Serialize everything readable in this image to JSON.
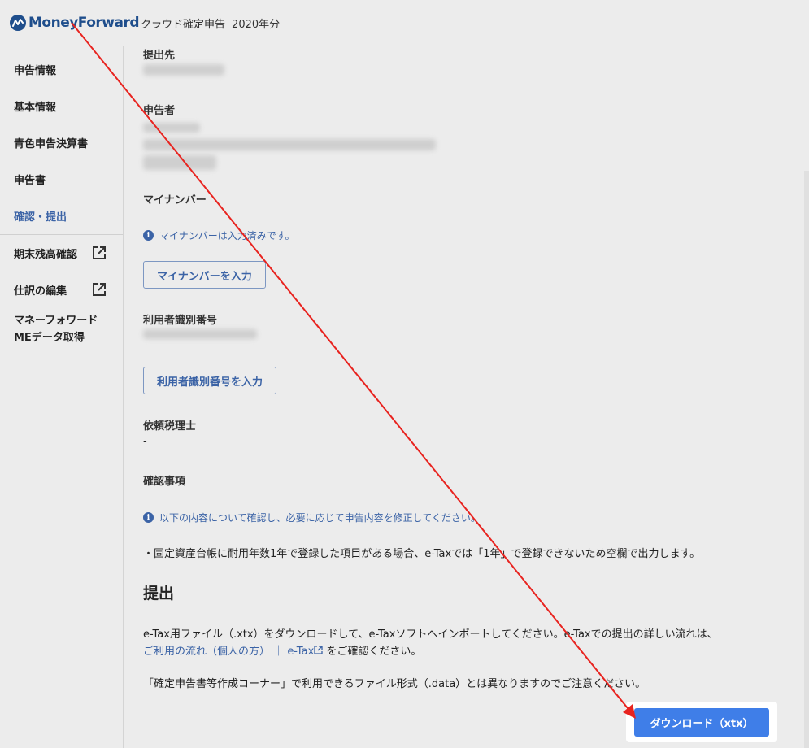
{
  "header": {
    "logo_text": "MoneyForward",
    "product": "クラウド確定申告",
    "year": "2020年分"
  },
  "sidebar": {
    "items": [
      {
        "label": "申告情報"
      },
      {
        "label": "基本情報"
      },
      {
        "label": "青色申告決算書"
      },
      {
        "label": "申告書"
      },
      {
        "label": "確認・提出"
      },
      {
        "label": "期末残高確認"
      },
      {
        "label": "仕訳の編集"
      },
      {
        "label_line1": "マネーフォワード",
        "label_line2": "MEデータ取得"
      }
    ]
  },
  "main": {
    "submit_to_label": "提出先",
    "filer_label": "申告者",
    "mynumber_label": "マイナンバー",
    "mynumber_info": "マイナンバーは入力済みです。",
    "mynumber_button": "マイナンバーを入力",
    "user_id_label": "利用者識別番号",
    "user_id_button": "利用者識別番号を入力",
    "tax_accountant_label": "依頼税理士",
    "tax_accountant_value": "-",
    "confirm_label": "確認事項",
    "confirm_info": "以下の内容について確認し、必要に応じて申告内容を修正してください。",
    "confirm_item": "・固定資産台帳に耐用年数1年で登録した項目がある場合、e-Taxでは「1年」で登録できないため空欄で出力します。",
    "submit_title": "提出",
    "submit_text_1": "e-Tax用ファイル（.xtx）をダウンロードして、e-Taxソフトへインポートしてください。e-Taxでの提出の詳しい流れは、",
    "submit_link_1": "ご利用の流れ（個人の方）",
    "submit_link_sep": "｜",
    "submit_link_2": "e-Tax",
    "submit_text_2": "をご確認ください。",
    "submit_note": "「確定申告書等作成コーナー」で利用できるファイル形式（.data）とは異なりますのでご注意ください。",
    "download_button": "ダウンロード（xtx）"
  },
  "colors": {
    "accent": "#3b63a6",
    "primary_button": "#3f7ee8",
    "annotation_arrow": "#e8231f"
  }
}
